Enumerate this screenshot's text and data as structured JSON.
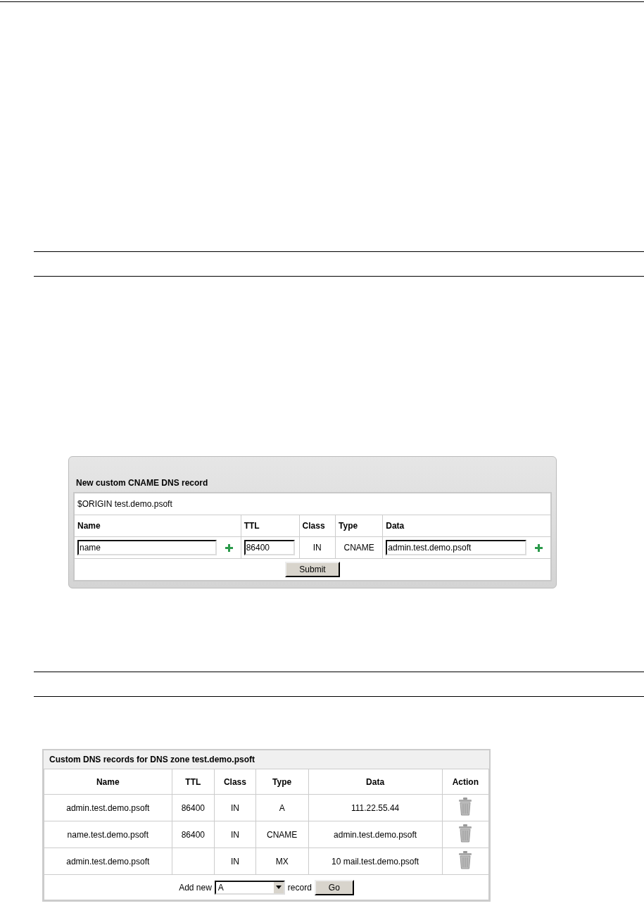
{
  "new_record_panel": {
    "title": "New custom CNAME DNS record",
    "origin": "$ORIGIN test.demo.psoft",
    "columns": [
      "Name",
      "TTL",
      "Class",
      "Type",
      "Data"
    ],
    "name_value": "name",
    "ttl_value": "86400",
    "class": "IN",
    "type": "CNAME",
    "data_value": "admin.test.demo.psoft",
    "submit": "Submit"
  },
  "records_panel": {
    "title": "Custom DNS records for DNS zone test.demo.psoft",
    "columns": [
      "Name",
      "TTL",
      "Class",
      "Type",
      "Data",
      "Action"
    ],
    "rows": [
      {
        "name": "admin.test.demo.psoft",
        "ttl": "86400",
        "class": "IN",
        "type": "A",
        "data": "111.22.55.44"
      },
      {
        "name": "name.test.demo.psoft",
        "ttl": "86400",
        "class": "IN",
        "type": "CNAME",
        "data": "admin.test.demo.psoft"
      },
      {
        "name": "admin.test.demo.psoft",
        "class": "IN",
        "type": "MX",
        "data": "10 mail.test.demo.psoft"
      }
    ],
    "footer": {
      "prefix": "Add new",
      "select_value": "A",
      "suffix": "record",
      "go": "Go"
    }
  }
}
